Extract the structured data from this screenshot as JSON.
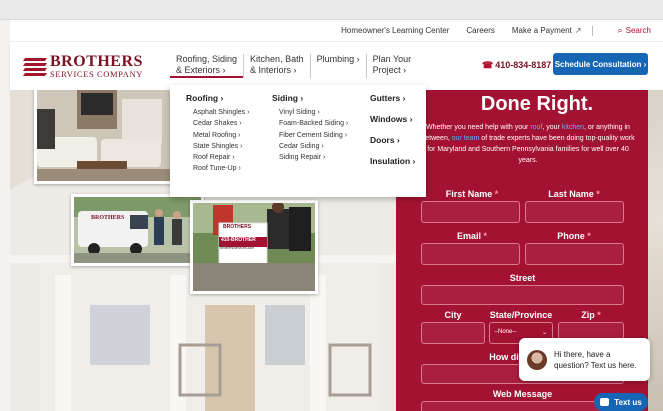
{
  "topbar": {
    "learning": "Homeowner's Learning Center",
    "careers": "Careers",
    "payment": "Make a Payment",
    "search": "Search"
  },
  "logo": {
    "line1": "BROTHERS",
    "line2": "SERVICES COMPANY"
  },
  "nav": [
    {
      "label": "Roofing, Siding\n& Exteriors ›"
    },
    {
      "label": "Kitchen, Bath\n& Interiors ›"
    },
    {
      "label": "Plumbing ›"
    },
    {
      "label": "Plan Your\nProject ›"
    }
  ],
  "header": {
    "phone": "410-834-8187",
    "cta": "Schedule Consultation ›"
  },
  "mega_menu": {
    "roofing": {
      "title": "Roofing ›",
      "items": [
        "Asphalt Shingles ›",
        "Cedar Shakes ›",
        "Metal Roofing ›",
        "State Shingles ›",
        "Roof Repair ›",
        "Roof Tune-Up ›"
      ]
    },
    "siding": {
      "title": "Siding ›",
      "items": [
        "Vinyl Siding ›",
        "Foam-Backed Siding ›",
        "Fiber Cement Siding ›",
        "Cedar Siding ›",
        "Siding Repair ›"
      ]
    },
    "gutters": "Gutters ›",
    "windows": "Windows ›",
    "doors": "Doors ›",
    "insulation": "Insulation ›"
  },
  "photos": {
    "van_label": "BROTHERS",
    "sign_line1": "BROTHERS",
    "sign_line2": "410-BROTHER",
    "sign_line3": "BrothersServices.com"
  },
  "form": {
    "heading": "Done Right.",
    "intro_a": "Whether you need help with your ",
    "intro_roof": "roof",
    "intro_b": ", your ",
    "intro_kitchen": "kitchen",
    "intro_c": ", or anything in between, ",
    "intro_team": "our team",
    "intro_d": " of trade experts have been doing top-quality work for Maryland and Southern Pennsylvania families for well over 40 years.",
    "first_name": "First Name",
    "last_name": "Last Name",
    "email": "Email",
    "phone": "Phone",
    "street": "Street",
    "city": "City",
    "state": "State/Province",
    "state_value": "--None--",
    "zip": "Zip",
    "how": "How did you",
    "message": "Web Message",
    "required_mark": "*"
  },
  "chat": {
    "message": "Hi there, have a question? Text us here.",
    "button": "Text us"
  },
  "colors": {
    "brand_red": "#a41233",
    "brand_blue": "#1566b5"
  }
}
